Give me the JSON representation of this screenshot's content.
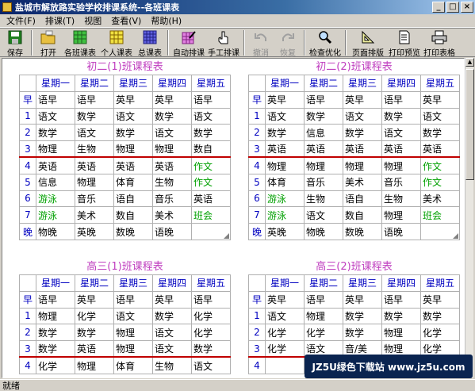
{
  "window": {
    "title": "盐城市解放路实验学校排课系统--各班课表"
  },
  "menu": [
    "文件(F)",
    "排课(T)",
    "视图",
    "查看(V)",
    "帮助(H)"
  ],
  "toolbar": {
    "save": "保存",
    "open": "打开",
    "class_schedule": "各班课表",
    "personal_schedule": "个人课表",
    "total_schedule": "总课表",
    "auto_schedule": "自动排课",
    "manual_schedule": "手工排课",
    "undo": "撤消",
    "redo": "恢复",
    "check_optimize": "检查优化",
    "page_layout": "页面排版",
    "print_preview": "打印预览",
    "print_table": "打印表格"
  },
  "status": "就绪",
  "watermark": "JZ5U绿色下载站 www.jz5u.com",
  "timetables": [
    {
      "title": "初二(1)班课程表",
      "headers": [
        "星期一",
        "星期二",
        "星期三",
        "星期四",
        "星期五"
      ],
      "rows": [
        {
          "label": "早",
          "cells": [
            "语早",
            "语早",
            "英早",
            "英早",
            "语早"
          ]
        },
        {
          "label": "1",
          "cells": [
            "语文",
            "数学",
            "语文",
            "数学",
            "语文"
          ]
        },
        {
          "label": "2",
          "cells": [
            "数学",
            "语文",
            "数学",
            "语文",
            "数学"
          ]
        },
        {
          "label": "3",
          "cells": [
            "物理",
            "生物",
            "物理",
            "物理",
            "数自"
          ]
        },
        {
          "label": "4",
          "cells": [
            "英语",
            "英语",
            "英语",
            "英语",
            "作文"
          ]
        },
        {
          "label": "5",
          "cells": [
            "信息",
            "物理",
            "体育",
            "生物",
            "作文"
          ]
        },
        {
          "label": "6",
          "cells": [
            "游泳",
            "音乐",
            "语自",
            "音乐",
            "英语"
          ]
        },
        {
          "label": "7",
          "cells": [
            "游泳",
            "美术",
            "数自",
            "美术",
            "班会"
          ]
        },
        {
          "label": "晚",
          "cells": [
            "物晚",
            "英晚",
            "数晚",
            "语晚",
            ""
          ]
        }
      ]
    },
    {
      "title": "初二(2)班课程表",
      "headers": [
        "星期一",
        "星期二",
        "星期三",
        "星期四",
        "星期五"
      ],
      "rows": [
        {
          "label": "早",
          "cells": [
            "英早",
            "语早",
            "英早",
            "语早",
            "英早"
          ]
        },
        {
          "label": "1",
          "cells": [
            "语文",
            "数学",
            "语文",
            "数学",
            "语文"
          ]
        },
        {
          "label": "2",
          "cells": [
            "数学",
            "信息",
            "数学",
            "语文",
            "数学"
          ]
        },
        {
          "label": "3",
          "cells": [
            "英语",
            "英语",
            "英语",
            "英语",
            "英语"
          ]
        },
        {
          "label": "4",
          "cells": [
            "物理",
            "物理",
            "物理",
            "物理",
            "作文"
          ]
        },
        {
          "label": "5",
          "cells": [
            "体育",
            "音乐",
            "美术",
            "音乐",
            "作文"
          ]
        },
        {
          "label": "6",
          "cells": [
            "游泳",
            "生物",
            "语自",
            "生物",
            "美术"
          ]
        },
        {
          "label": "7",
          "cells": [
            "游泳",
            "语文",
            "数自",
            "物理",
            "班会"
          ]
        },
        {
          "label": "晚",
          "cells": [
            "英晚",
            "物晚",
            "数晚",
            "语晚",
            ""
          ]
        }
      ]
    },
    {
      "title": "高三(1)班课程表",
      "headers": [
        "星期一",
        "星期二",
        "星期三",
        "星期四",
        "星期五"
      ],
      "rows": [
        {
          "label": "早",
          "cells": [
            "语早",
            "英早",
            "语早",
            "英早",
            "语早"
          ]
        },
        {
          "label": "1",
          "cells": [
            "物理",
            "化学",
            "语文",
            "数学",
            "化学"
          ]
        },
        {
          "label": "2",
          "cells": [
            "数学",
            "数学",
            "物理",
            "语文",
            "化学"
          ]
        },
        {
          "label": "3",
          "cells": [
            "数学",
            "英语",
            "物理",
            "语文",
            "数学"
          ]
        },
        {
          "label": "4",
          "cells": [
            "化学",
            "物理",
            "体育",
            "生物",
            "语文"
          ]
        }
      ]
    },
    {
      "title": "高三(2)班课程表",
      "headers": [
        "星期一",
        "星期二",
        "星期三",
        "星期四",
        "星期五"
      ],
      "rows": [
        {
          "label": "早",
          "cells": [
            "英早",
            "语早",
            "英早",
            "语早",
            "英早"
          ]
        },
        {
          "label": "1",
          "cells": [
            "语文",
            "物理",
            "数学",
            "数学",
            "数学"
          ]
        },
        {
          "label": "2",
          "cells": [
            "化学",
            "化学",
            "数学",
            "物理",
            "化学"
          ]
        },
        {
          "label": "3",
          "cells": [
            "化学",
            "语文",
            "音/美",
            "物理",
            "化学"
          ]
        },
        {
          "label": "4",
          "cells": [
            "",
            "",
            "",
            "",
            ""
          ]
        }
      ]
    }
  ]
}
